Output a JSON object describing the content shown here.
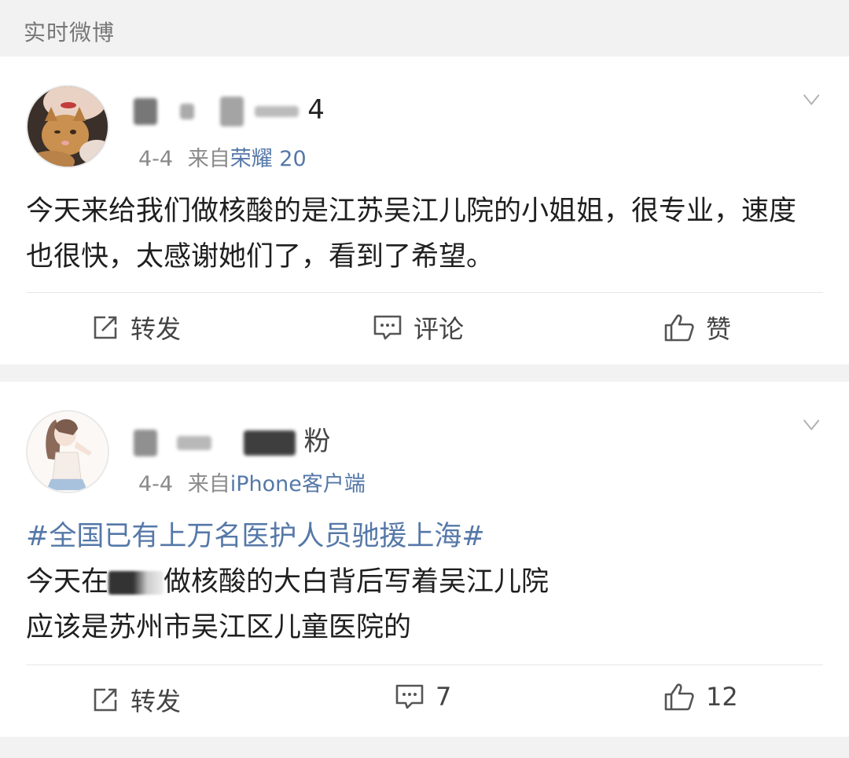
{
  "section": {
    "title": "实时微博"
  },
  "posts": [
    {
      "username_visible": "4",
      "date": "4-4",
      "from_label": "来自",
      "source": "荣耀 20",
      "text": "今天来给我们做核酸的是江苏吴江儿院的小姐姐，很专业，速度也很快，太感谢她们了，看到了希望。",
      "actions": {
        "repost": "转发",
        "comment": "评论",
        "like": "赞"
      },
      "avatar_icon": "cat-avatar-icon"
    },
    {
      "username_visible": "粉",
      "date": "4-4",
      "from_label": "来自",
      "source": "iPhone客户端",
      "hashtag": "#全国已有上万名医护人员驰援上海#",
      "text_line1_a": "今天在",
      "text_line1_b": "做核酸的大白背后写着吴江儿院",
      "text_line2": "应该是苏州市吴江区儿童医院的",
      "actions": {
        "repost": "转发",
        "comment": "7",
        "like": "12"
      },
      "avatar_icon": "girl-avatar-icon"
    }
  ],
  "colors": {
    "link": "#5578a8",
    "background": "#f2f2f2",
    "card": "#ffffff"
  }
}
